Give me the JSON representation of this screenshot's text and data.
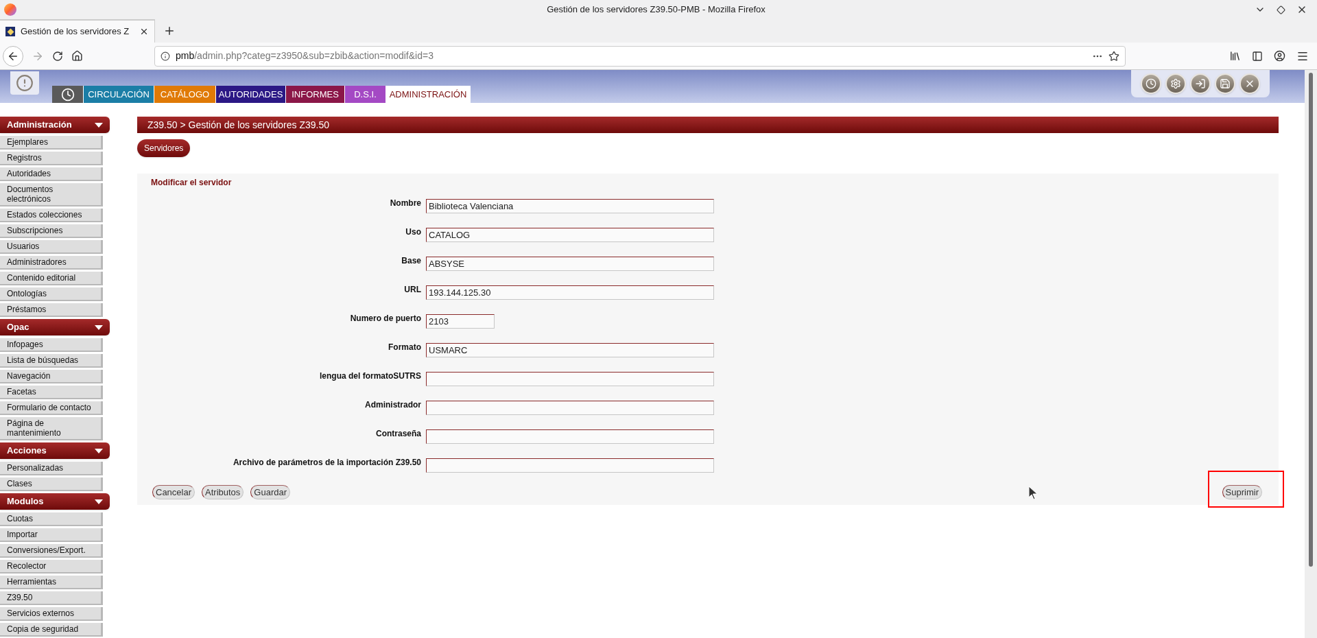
{
  "browser": {
    "window_title": "Gestión de los servidores Z39.50-PMB - Mozilla Firefox",
    "tab_title": "Gestión de los servidores Z",
    "url_host": "pmb",
    "url_path": "/admin.php?categ=z3950&sub=zbib&action=modif&id=3"
  },
  "module_tabs": [
    {
      "kind": "clock",
      "selected": false,
      "color": "#5a5a5a"
    },
    {
      "label": "CIRCULACIÓN",
      "selected": false,
      "color": "#1b7ea6"
    },
    {
      "label": "CATÁLOGO",
      "selected": false,
      "color": "#e07a06"
    },
    {
      "label": "AUTORIDADES",
      "selected": false,
      "color": "#2b1885"
    },
    {
      "label": "INFORMES",
      "selected": false,
      "color": "#8b1748"
    },
    {
      "label": "D.S.I.",
      "selected": false,
      "color": "#a449c4"
    },
    {
      "label": "ADMINISTRACIÓN",
      "selected": true,
      "color": "#ffffff"
    }
  ],
  "sidebar": [
    {
      "title": "Administración",
      "items": [
        "Ejemplares",
        "Registros",
        "Autoridades",
        "Documentos electrónicos",
        "Estados colecciones",
        "Subscripciones",
        "Usuarios",
        "Administradores",
        "Contenido editorial",
        "Ontologías",
        "Préstamos"
      ]
    },
    {
      "title": "Opac",
      "items": [
        "Infopages",
        "Lista de búsquedas",
        "Navegación",
        "Facetas",
        "Formulario de contacto",
        "Página de mantenimiento"
      ]
    },
    {
      "title": "Acciones",
      "items": [
        "Personalizadas",
        "Clases"
      ]
    },
    {
      "title": "Modulos",
      "items": [
        "Cuotas",
        "Importar",
        "Conversiones/Export.",
        "Recolector",
        "Herramientas",
        "Z39.50",
        "Servicios externos",
        "Copia de seguridad"
      ]
    }
  ],
  "breadcrumb": "Z39.50 > Gestión de los servidores Z39.50",
  "sub_button": "Servidores",
  "form": {
    "title": "Modificar el servidor",
    "fields": [
      {
        "label": "Nombre",
        "value": "Biblioteca Valenciana",
        "kind": "long"
      },
      {
        "label": "Uso",
        "value": "CATALOG",
        "kind": "long"
      },
      {
        "label": "Base",
        "value": "ABSYSE",
        "kind": "long"
      },
      {
        "label": "URL",
        "value": "193.144.125.30",
        "kind": "long"
      },
      {
        "label": "Numero de puerto",
        "value": "2103",
        "kind": "short"
      },
      {
        "label": "Formato",
        "value": "USMARC",
        "kind": "long"
      },
      {
        "label": "lengua del formatoSUTRS",
        "kind": "long"
      },
      {
        "label": "Administrador",
        "kind": "long"
      },
      {
        "label": "Contraseña",
        "kind": "long"
      },
      {
        "label": "Archivo de parámetros de la importación Z39.50",
        "kind": "long"
      }
    ],
    "buttons": [
      "Cancelar",
      "Atributos",
      "Guardar"
    ],
    "delete_button": "Suprimir"
  }
}
